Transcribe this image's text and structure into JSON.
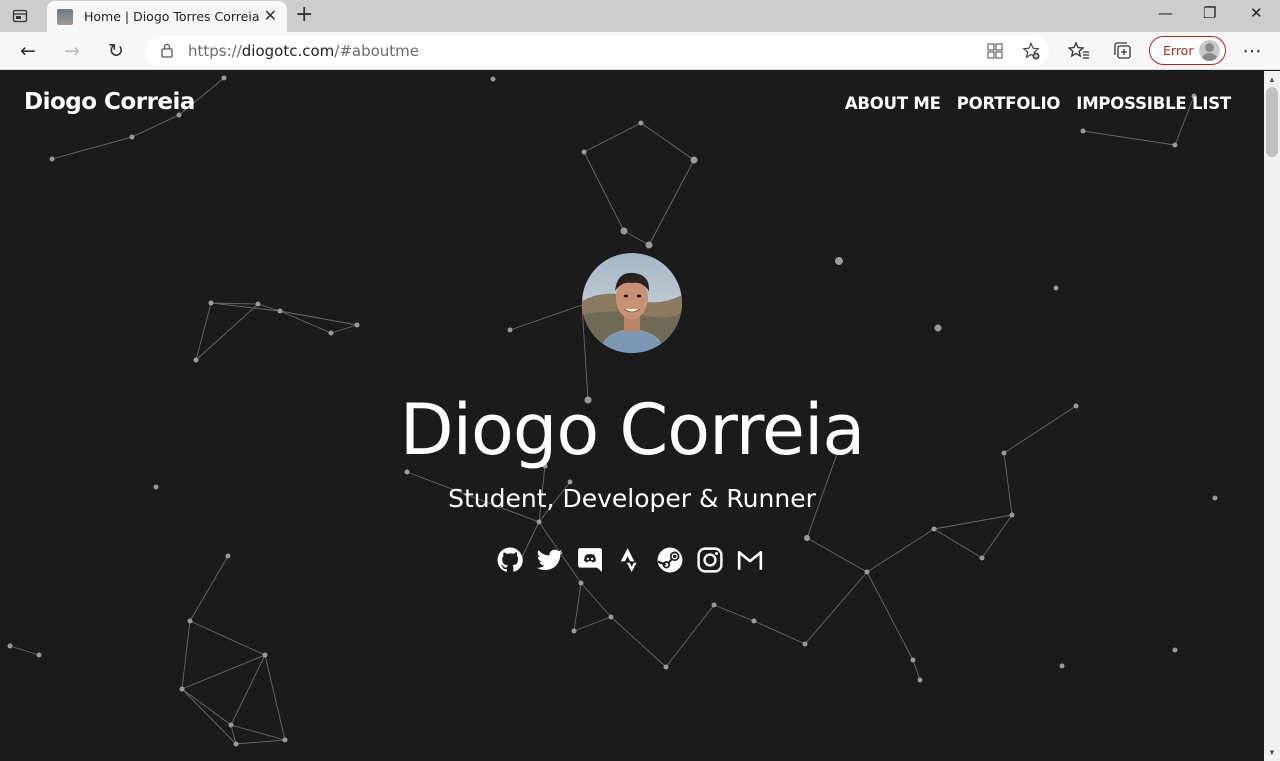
{
  "browser": {
    "tab": {
      "title": "Home | Diogo Torres Correia",
      "close": "✕"
    },
    "new_tab": "+",
    "window_controls": {
      "minimize": "—",
      "restore": "❐",
      "close": "✕"
    },
    "nav": {
      "back": "←",
      "forward": "→",
      "reload": "↻"
    },
    "address": {
      "prefix": "https://",
      "host": "diogotc.com",
      "path": "/#aboutme"
    },
    "profile": {
      "label": "Error"
    },
    "more": "⋯"
  },
  "site": {
    "brand": "Diogo Correia",
    "nav": [
      "ABOUT ME",
      "PORTFOLIO",
      "IMPOSSIBLE LIST"
    ],
    "hero": {
      "title": "Diogo Correia",
      "subtitle": "Student, Developer & Runner"
    },
    "socials": [
      "github-icon",
      "twitter-icon",
      "discord-icon",
      "strava-icon",
      "steam-icon",
      "instagram-icon",
      "gmail-icon"
    ]
  },
  "colors": {
    "background": "#1b1b1b",
    "text": "#ffffff",
    "particle": "#9a9a9a",
    "link_line": "#6a6a6a",
    "profile_error": "#b3261e"
  }
}
